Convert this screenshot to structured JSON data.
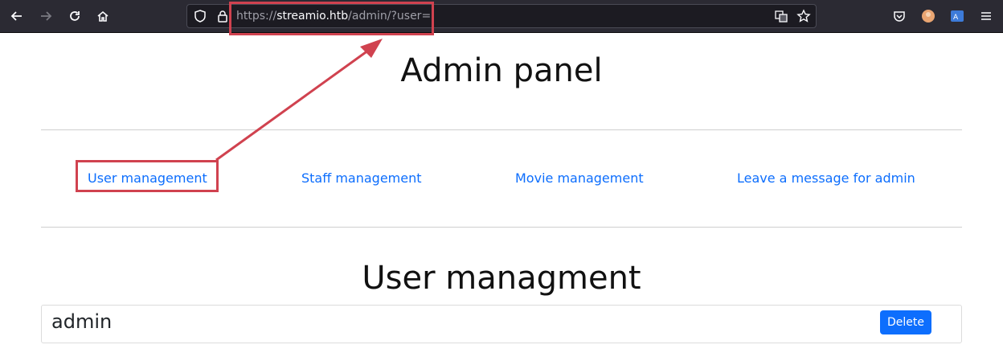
{
  "browser": {
    "url_scheme": "https://",
    "url_host": "streamio.htb",
    "url_path": "/admin/?user=",
    "icons": [
      "back-arrow-icon",
      "forward-arrow-icon",
      "reload-icon",
      "home-icon",
      "shield-icon",
      "lock-icon",
      "translate-icon",
      "bookmark-star-icon",
      "pocket-icon",
      "account-icon",
      "language-icon",
      "menu-icon"
    ]
  },
  "page": {
    "title": "Admin panel",
    "nav": [
      {
        "label": "User management"
      },
      {
        "label": "Staff management"
      },
      {
        "label": "Movie management"
      },
      {
        "label": "Leave a message for admin"
      }
    ],
    "section_title": "User managment",
    "users": [
      {
        "name": "admin",
        "action": "Delete"
      }
    ]
  },
  "colors": {
    "link": "#0d6efd",
    "button": "#0d6efd",
    "annotation": "#d0424f",
    "toolbar": "#2b2a33"
  }
}
